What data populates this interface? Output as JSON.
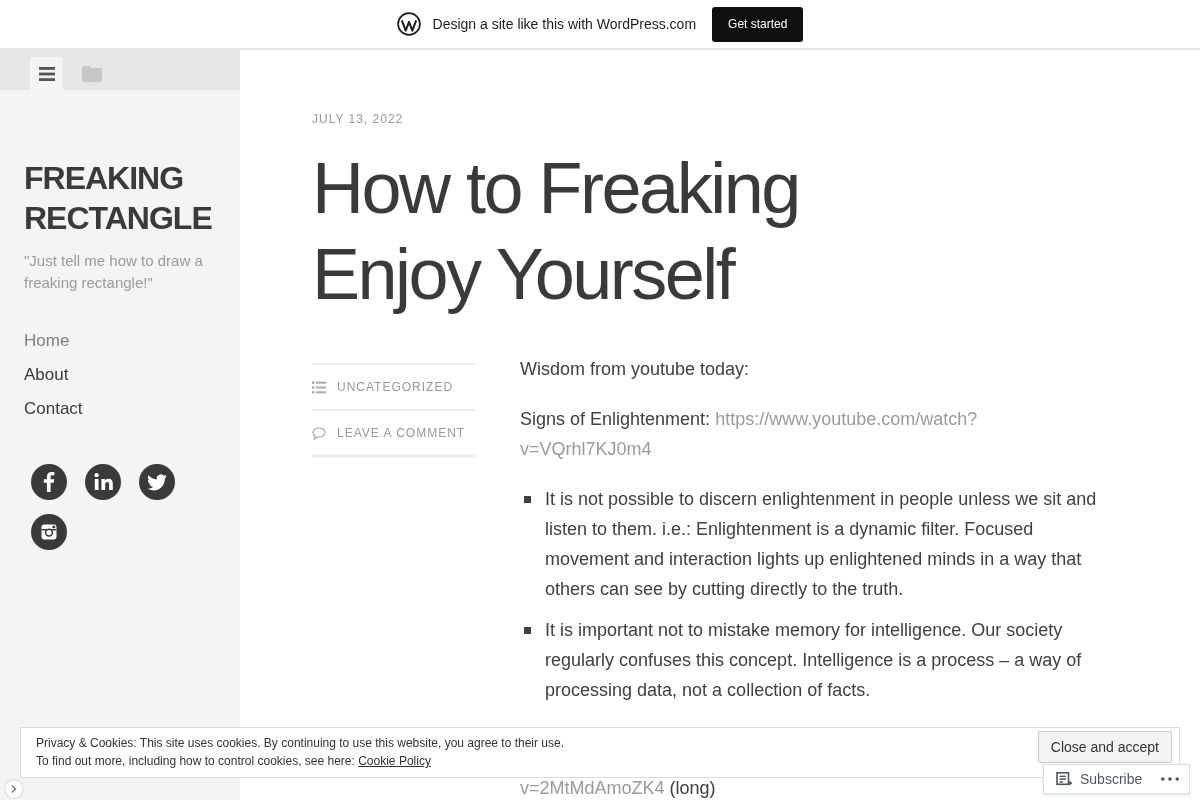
{
  "promo_bar": {
    "text": "Design a site like this with WordPress.com",
    "button": "Get started"
  },
  "sidebar": {
    "tabs": [
      {
        "kind": "menu",
        "selected": true
      },
      {
        "kind": "folder",
        "selected": false
      }
    ],
    "site_title": "FREAKING RECTANGLE",
    "tagline": "\"Just tell me how to draw a freaking rectangle!\"",
    "nav": [
      {
        "label": "Home",
        "selected": true
      },
      {
        "label": "About",
        "selected": false
      },
      {
        "label": "Contact",
        "selected": false
      }
    ],
    "social_links": [
      {
        "kind": "facebook"
      },
      {
        "kind": "linkedin"
      },
      {
        "kind": "twitter"
      },
      {
        "kind": "instagram"
      }
    ]
  },
  "post": {
    "date": "JULY 13, 2022",
    "title": "How to Freaking Enjoy Yourself",
    "meta": [
      {
        "kind": "category",
        "label": "UNCATEGORIZED"
      },
      {
        "kind": "comments",
        "label": "LEAVE A COMMENT"
      }
    ],
    "body": [
      {
        "kind": "paragraph",
        "text": "Wisdom from youtube today:"
      },
      {
        "kind": "paragraph",
        "text": "Signs of Enlightenment:",
        "link_lines": [
          "https://www.youtube.com/watch?",
          "v=VQrhl7KJ0m4"
        ]
      },
      {
        "kind": "list",
        "items": [
          "It is not possible to discern enlightenment in people unless we sit and listen to them. i.e.: Enlightenment is a dynamic filter. Focused movement and interaction lights up enlightened minds in a way that others can see by cutting directly to the truth.",
          "It is important not to mistake memory for intelligence. Our society regularly confuses this concept. Intelligence is a process – a way of processing data, not a collection of facts."
        ]
      },
      {
        "kind": "paragraph",
        "link_lines": [
          "v=2MtMdAmoZK4"
        ],
        "after": "(long)"
      }
    ]
  },
  "cookie_banner": {
    "lines": [
      "Privacy & Cookies: This site uses cookies. By continuing to use this website, you agree to their use.",
      "To find out more, including how to control cookies, see here:"
    ],
    "link": "Cookie Policy",
    "button": "Close and accept"
  },
  "subscribe_bar": {
    "label": "Subscribe"
  }
}
